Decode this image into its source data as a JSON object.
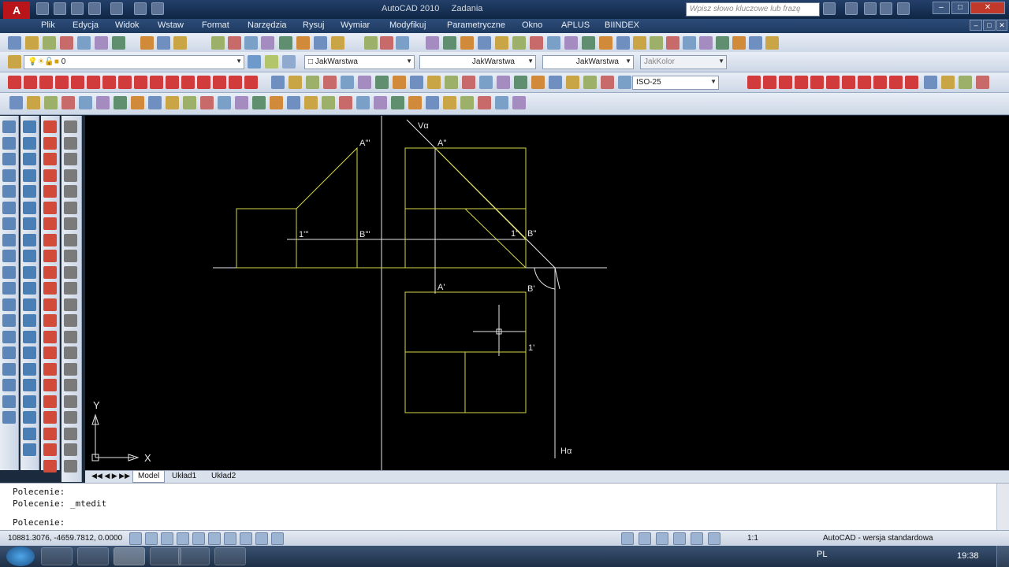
{
  "window": {
    "app_title": "AutoCAD 2010",
    "doc_title": "Zadania",
    "search_placeholder": "Wpisz słowo kluczowe lub frazę",
    "logo_letter": "A"
  },
  "menu": [
    "Plik",
    "Edycja",
    "Widok",
    "Wstaw",
    "Format",
    "Narzędzia",
    "Rysuj",
    "Wymiar",
    "Modyfikuj",
    "Parametryczne",
    "Okno",
    "APLUS",
    "BIINDEX"
  ],
  "layers": {
    "current_layer": "0",
    "color": "JakWarstwa",
    "linetype": "JakWarstwa",
    "lineweight": "JakWarstwa",
    "plotstyle": "JakKolor"
  },
  "dim_style": "ISO-25",
  "drawing_labels": {
    "v_alpha": "Vα",
    "h_alpha": "Hα",
    "a3": "A'''",
    "a2": "A''",
    "a1": "A'",
    "b3": "B'''",
    "b2": "B''",
    "b1": "B'",
    "p3": "1'''",
    "p2": "1''",
    "p1": "1'",
    "ucs_x": "X",
    "ucs_y": "Y"
  },
  "layout_tabs": [
    "Model",
    "Układ1",
    "Układ2"
  ],
  "command_lines": [
    "Polecenie:",
    "Polecenie: _mtedit",
    "Polecenie:"
  ],
  "status": {
    "coords": "10881.3076, -4659.7812, 0.0000",
    "scale": "1:1",
    "workspace": "AutoCAD - wersja standardowa"
  },
  "tray": {
    "language": "PL",
    "time": "19:38"
  },
  "colors": {
    "drawing_lines": "#d6d64a",
    "construction_lines": "#e6e6e6",
    "canvas": "#000000"
  }
}
